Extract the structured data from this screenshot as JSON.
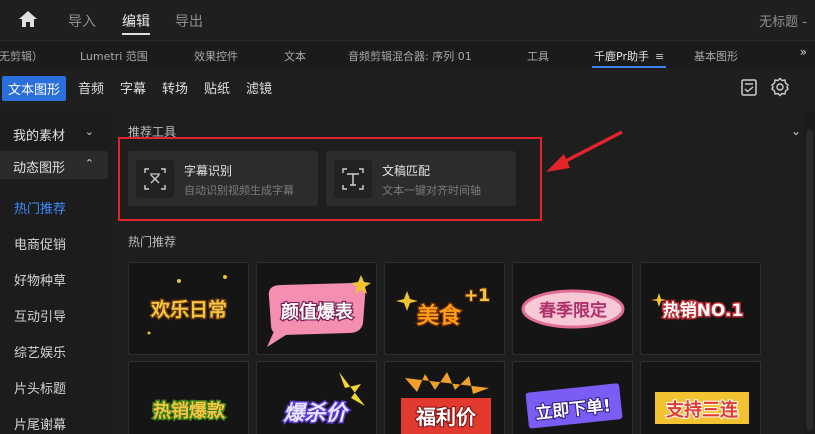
{
  "topbar": {
    "nav": [
      {
        "label": "导入"
      },
      {
        "label": "编辑"
      },
      {
        "label": "导出"
      }
    ],
    "doc_title": "无标题 -"
  },
  "panel_tabs": [
    {
      "label": "无剪辑）"
    },
    {
      "label": "Lumetri 范围"
    },
    {
      "label": "效果控件"
    },
    {
      "label": "文本"
    },
    {
      "label": "音频剪辑混合器: 序列 01"
    },
    {
      "label": "工具"
    },
    {
      "label": "千鹿Pr助手"
    },
    {
      "label": "基本图形"
    }
  ],
  "panel_menu_glyph": "≡",
  "panel_expand_glyph": "»",
  "categories": [
    {
      "label": "文本图形"
    },
    {
      "label": "音频"
    },
    {
      "label": "字幕"
    },
    {
      "label": "转场"
    },
    {
      "label": "贴纸"
    },
    {
      "label": "滤镜"
    }
  ],
  "sidebar": {
    "my_materials": "我的素材",
    "motion_graphics": "动态图形",
    "items": [
      {
        "label": "热门推荐"
      },
      {
        "label": "电商促销"
      },
      {
        "label": "好物种草"
      },
      {
        "label": "互动引导"
      },
      {
        "label": "综艺娱乐"
      },
      {
        "label": "片头标题"
      },
      {
        "label": "片尾谢幕"
      }
    ]
  },
  "main": {
    "recommended_tools_title": "推荐工具",
    "tools": [
      {
        "title": "字幕识别",
        "desc": "自动识别视频生成字幕"
      },
      {
        "title": "文稿匹配",
        "desc": "文本一键对齐时间轴"
      }
    ],
    "hot_title": "热门推荐",
    "stickers_row1": [
      "欢乐日常",
      "颜值爆表",
      "美食",
      "春季限定",
      "热销NO.1"
    ],
    "sticker_extra": "+1",
    "stickers_row2": [
      "热销爆款",
      "爆杀价",
      "福利价",
      "立即下单!",
      "支持三连"
    ]
  },
  "colors": {
    "accent": "#2a6fdb",
    "active_link": "#3d8bff",
    "highlight_box": "#e3242b"
  }
}
